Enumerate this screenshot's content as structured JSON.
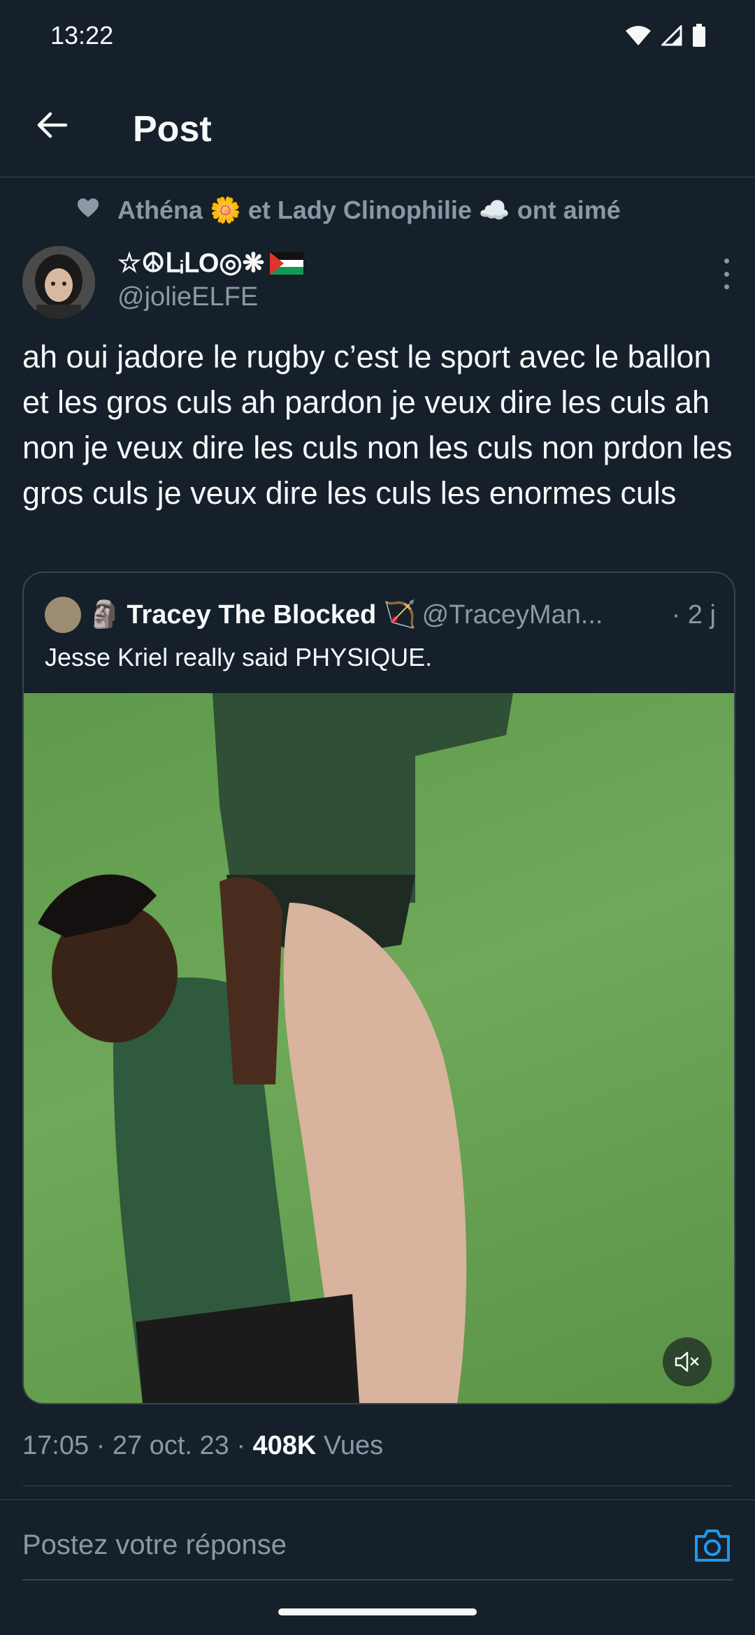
{
  "status_bar": {
    "time": "13:22",
    "icons": [
      "wifi-icon",
      "signal-icon",
      "battery-icon"
    ]
  },
  "header": {
    "title": "Post"
  },
  "social_context": {
    "text": "Athéna 🌼 et Lady Clinophilie ☁️ ont aimé"
  },
  "author": {
    "display_name": "☆☮ᒪᵢᒪO◎❋",
    "handle": "@jolieELFE"
  },
  "post": {
    "text": "ah oui jadore le rugby c’est le sport avec le ballon et les gros culs ah pardon je veux dire les culs ah non je veux dire les culs non les culs non prdon les gros culs je veux dire les culs les enormes culs",
    "time": "17:05 · 27 oct. 23 · ",
    "views_count": "408K",
    "views_label": " Vues"
  },
  "quote": {
    "name": "Tracey The Blocked",
    "name_emoji": "🏹",
    "handle": "@TraceyMan...",
    "time": "· 2 j",
    "text": "Jesse Kriel really said PHYSIQUE."
  },
  "reply": {
    "placeholder": "Postez votre réponse"
  },
  "colors": {
    "background": "#15202b",
    "muted": "#8b98a5",
    "accent": "#1d9bf0",
    "border": "#38444d"
  }
}
